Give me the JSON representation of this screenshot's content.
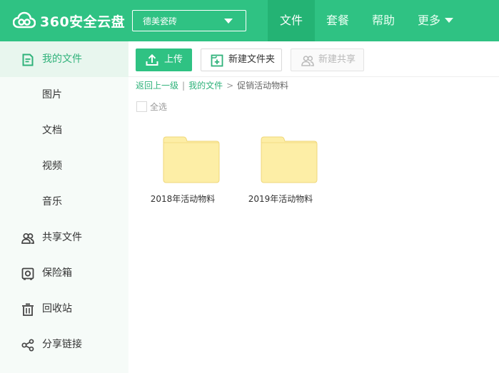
{
  "header": {
    "logo_text": "360安全云盘",
    "account_name": "德美瓷砖",
    "nav": [
      {
        "label": "文件",
        "active": true
      },
      {
        "label": "套餐"
      },
      {
        "label": "帮助"
      },
      {
        "label": "更多"
      }
    ]
  },
  "sidebar": {
    "items": [
      {
        "label": "我的文件",
        "icon": "file-icon",
        "active": true
      },
      {
        "label": "图片"
      },
      {
        "label": "文档"
      },
      {
        "label": "视频"
      },
      {
        "label": "音乐"
      },
      {
        "label": "共享文件",
        "icon": "users-icon"
      },
      {
        "label": "保险箱",
        "icon": "safe-icon"
      },
      {
        "label": "回收站",
        "icon": "trash-icon"
      },
      {
        "label": "分享链接",
        "icon": "share-icon"
      }
    ]
  },
  "toolbar": {
    "upload_label": "上传",
    "new_folder_label": "新建文件夹",
    "new_share_label": "新建共享"
  },
  "breadcrumb": {
    "back": "返回上一级",
    "separator": "|",
    "root": "我的文件",
    "arrow": ">",
    "current": "促销活动物料"
  },
  "select_all_label": "全选",
  "folders": [
    {
      "name": "2018年活动物料"
    },
    {
      "name": "2019年活动物料"
    }
  ],
  "colors": {
    "brand": "#2fc283",
    "folder": "#fdeea6"
  }
}
